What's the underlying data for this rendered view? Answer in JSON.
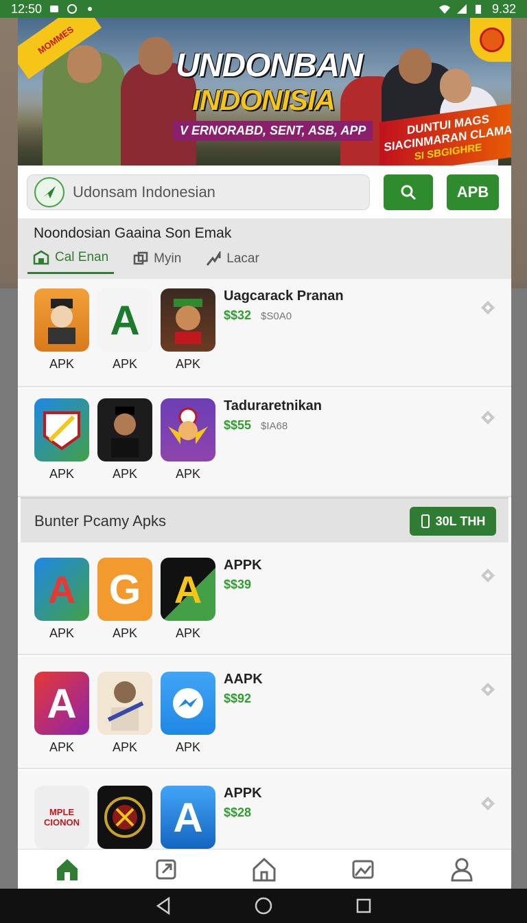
{
  "status_bar": {
    "time": "12:50",
    "battery": "9.32"
  },
  "banner": {
    "corner_tag": "MOMMES",
    "title_line1": "UNDONBAN",
    "title_line2": "INDONISIA",
    "subtitle": "V ERNORABD, SENT, ASB, APP",
    "promo_line1": "DUNTUI MAGS",
    "promo_line2": "SIACINMARAN CLAMA",
    "promo_line3": "SI SBGIGHRE"
  },
  "search": {
    "placeholder": "Udonsam Indonesian",
    "search_button": "search",
    "apb_button": "APB"
  },
  "section1": {
    "title": "Noondosian Gaaina Son Emak",
    "tabs": [
      {
        "label": "Cal Enan"
      },
      {
        "label": "Myin"
      },
      {
        "label": "Lacar"
      }
    ]
  },
  "rows": [
    {
      "title": "Uagcarack Pranan",
      "price": "$$32",
      "old_price": "$S0A0",
      "apps": [
        "APK",
        "APK",
        "APK"
      ]
    },
    {
      "title": "Taduraretnikan",
      "price": "$$55",
      "old_price": "$IA68",
      "apps": [
        "APK",
        "APK",
        "APK"
      ]
    },
    {
      "title": "APPK",
      "price": "$$39",
      "old_price": "",
      "apps": [
        "APK",
        "APK",
        "APK"
      ]
    },
    {
      "title": "AAPK",
      "price": "$$92",
      "old_price": "",
      "apps": [
        "APK",
        "APK",
        "APK"
      ]
    },
    {
      "title": "APPK",
      "price": "$$28",
      "old_price": "",
      "apps": [
        "",
        "",
        ""
      ]
    }
  ],
  "section2": {
    "title": "Bunter Pcamy Apks",
    "button": "30L THH"
  },
  "icon_labels": {
    "r1a": "",
    "r1b": "A",
    "r3a": "A",
    "r3b": "G",
    "r3c": "A",
    "r4a": "A",
    "r5a": "MPLE CIONON",
    "r5c": "A"
  },
  "bottom_nav": [
    "home-icon",
    "share-icon",
    "store-icon",
    "gallery-icon",
    "profile-icon"
  ],
  "colors": {
    "accent": "#2e7d32",
    "price": "#2e9e2e"
  }
}
